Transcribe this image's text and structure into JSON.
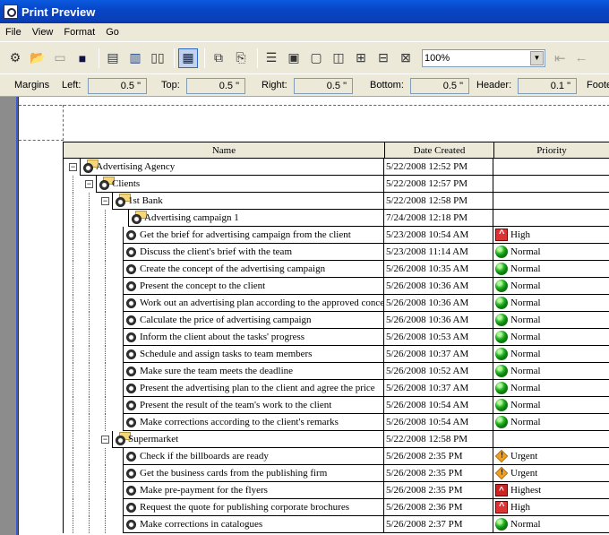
{
  "window": {
    "title": "Print Preview"
  },
  "menu": [
    "File",
    "View",
    "Format",
    "Go"
  ],
  "toolbar": {
    "buttons": [
      "options-icon",
      "open-icon",
      "folder-up-icon",
      "save-icon",
      "print-icon",
      "print-setup-icon",
      "book-icon",
      "single-page-icon",
      "copy-icon",
      "export-icon",
      "page-width-icon",
      "header-footer-icon",
      "one-page-icon",
      "two-pages-icon",
      "four-pages-icon",
      "six-pages-icon",
      "multiple-pages-icon"
    ],
    "zoom": "100%"
  },
  "margins": {
    "title": "Margins",
    "left_label": "Left:",
    "left": "0.5 \"",
    "top_label": "Top:",
    "top": "0.5 \"",
    "right_label": "Right:",
    "right": "0.5 \"",
    "bottom_label": "Bottom:",
    "bottom": "0.5 \"",
    "header_label": "Header:",
    "header": "0.1 \"",
    "footer_label": "Foote"
  },
  "grid": {
    "columns": [
      "Name",
      "Date Created",
      "Priority"
    ],
    "rows": [
      {
        "level": 0,
        "kind": "folder",
        "name": "Advertising Agency",
        "date": "5/22/2008 12:52 PM",
        "priority": "",
        "prio_icon": ""
      },
      {
        "level": 1,
        "kind": "folder",
        "name": "Clients",
        "date": "5/22/2008 12:57 PM",
        "priority": "",
        "prio_icon": ""
      },
      {
        "level": 2,
        "kind": "folder",
        "name": "1st Bank",
        "date": "5/22/2008 12:58 PM",
        "priority": "",
        "prio_icon": ""
      },
      {
        "level": 3,
        "kind": "folder-leaf",
        "name": "Advertising campaign 1",
        "date": "7/24/2008 12:18 PM",
        "priority": "",
        "prio_icon": ""
      },
      {
        "level": 3,
        "kind": "task",
        "name": "Get the brief for advertising campaign from the client",
        "date": "5/23/2008 10:54 AM",
        "priority": "High",
        "prio_icon": "high"
      },
      {
        "level": 3,
        "kind": "task",
        "name": "Discuss the client's brief with the team",
        "date": "5/23/2008 11:14 AM",
        "priority": "Normal",
        "prio_icon": "normal"
      },
      {
        "level": 3,
        "kind": "task",
        "name": "Create the concept of the advertising campaign",
        "date": "5/26/2008 10:35 AM",
        "priority": "Normal",
        "prio_icon": "normal"
      },
      {
        "level": 3,
        "kind": "task",
        "name": "Present the concept to the client",
        "date": "5/26/2008 10:36 AM",
        "priority": "Normal",
        "prio_icon": "normal"
      },
      {
        "level": 3,
        "kind": "task",
        "name": "Work out an advertising plan according to the approved concept",
        "date": "5/26/2008 10:36 AM",
        "priority": "Normal",
        "prio_icon": "normal"
      },
      {
        "level": 3,
        "kind": "task",
        "name": "Calculate the price of advertising campaign",
        "date": "5/26/2008 10:36 AM",
        "priority": "Normal",
        "prio_icon": "normal"
      },
      {
        "level": 3,
        "kind": "task",
        "name": "Inform the client about the tasks' progress",
        "date": "5/26/2008 10:53 AM",
        "priority": "Normal",
        "prio_icon": "normal"
      },
      {
        "level": 3,
        "kind": "task",
        "name": "Schedule and assign tasks to team members",
        "date": "5/26/2008 10:37 AM",
        "priority": "Normal",
        "prio_icon": "normal"
      },
      {
        "level": 3,
        "kind": "task",
        "name": "Make sure the team meets the deadline",
        "date": "5/26/2008 10:52 AM",
        "priority": "Normal",
        "prio_icon": "normal"
      },
      {
        "level": 3,
        "kind": "task",
        "name": "Present the advertising plan to the client and agree the price",
        "date": "5/26/2008 10:37 AM",
        "priority": "Normal",
        "prio_icon": "normal"
      },
      {
        "level": 3,
        "kind": "task",
        "name": "Present the result of the team's work to the client",
        "date": "5/26/2008 10:54 AM",
        "priority": "Normal",
        "prio_icon": "normal"
      },
      {
        "level": 3,
        "kind": "task",
        "name": "Make corrections according to the client's remarks",
        "date": "5/26/2008 10:54 AM",
        "priority": "Normal",
        "prio_icon": "normal"
      },
      {
        "level": 2,
        "kind": "folder",
        "name": "Supermarket",
        "date": "5/22/2008 12:58 PM",
        "priority": "",
        "prio_icon": ""
      },
      {
        "level": 3,
        "kind": "task",
        "name": "Check if the billboards are ready",
        "date": "5/26/2008 2:35 PM",
        "priority": "Urgent",
        "prio_icon": "urgent"
      },
      {
        "level": 3,
        "kind": "task",
        "name": "Get the business cards from the publishing firm",
        "date": "5/26/2008 2:35 PM",
        "priority": "Urgent",
        "prio_icon": "urgent"
      },
      {
        "level": 3,
        "kind": "task",
        "name": "Make pre-payment for the flyers",
        "date": "5/26/2008 2:35 PM",
        "priority": "Highest",
        "prio_icon": "highest"
      },
      {
        "level": 3,
        "kind": "task",
        "name": "Request the quote for publishing corporate brochures",
        "date": "5/26/2008 2:36 PM",
        "priority": "High",
        "prio_icon": "high"
      },
      {
        "level": 3,
        "kind": "task",
        "name": "Make corrections in catalogues",
        "date": "5/26/2008 2:37 PM",
        "priority": "Normal",
        "prio_icon": "normal"
      }
    ]
  }
}
